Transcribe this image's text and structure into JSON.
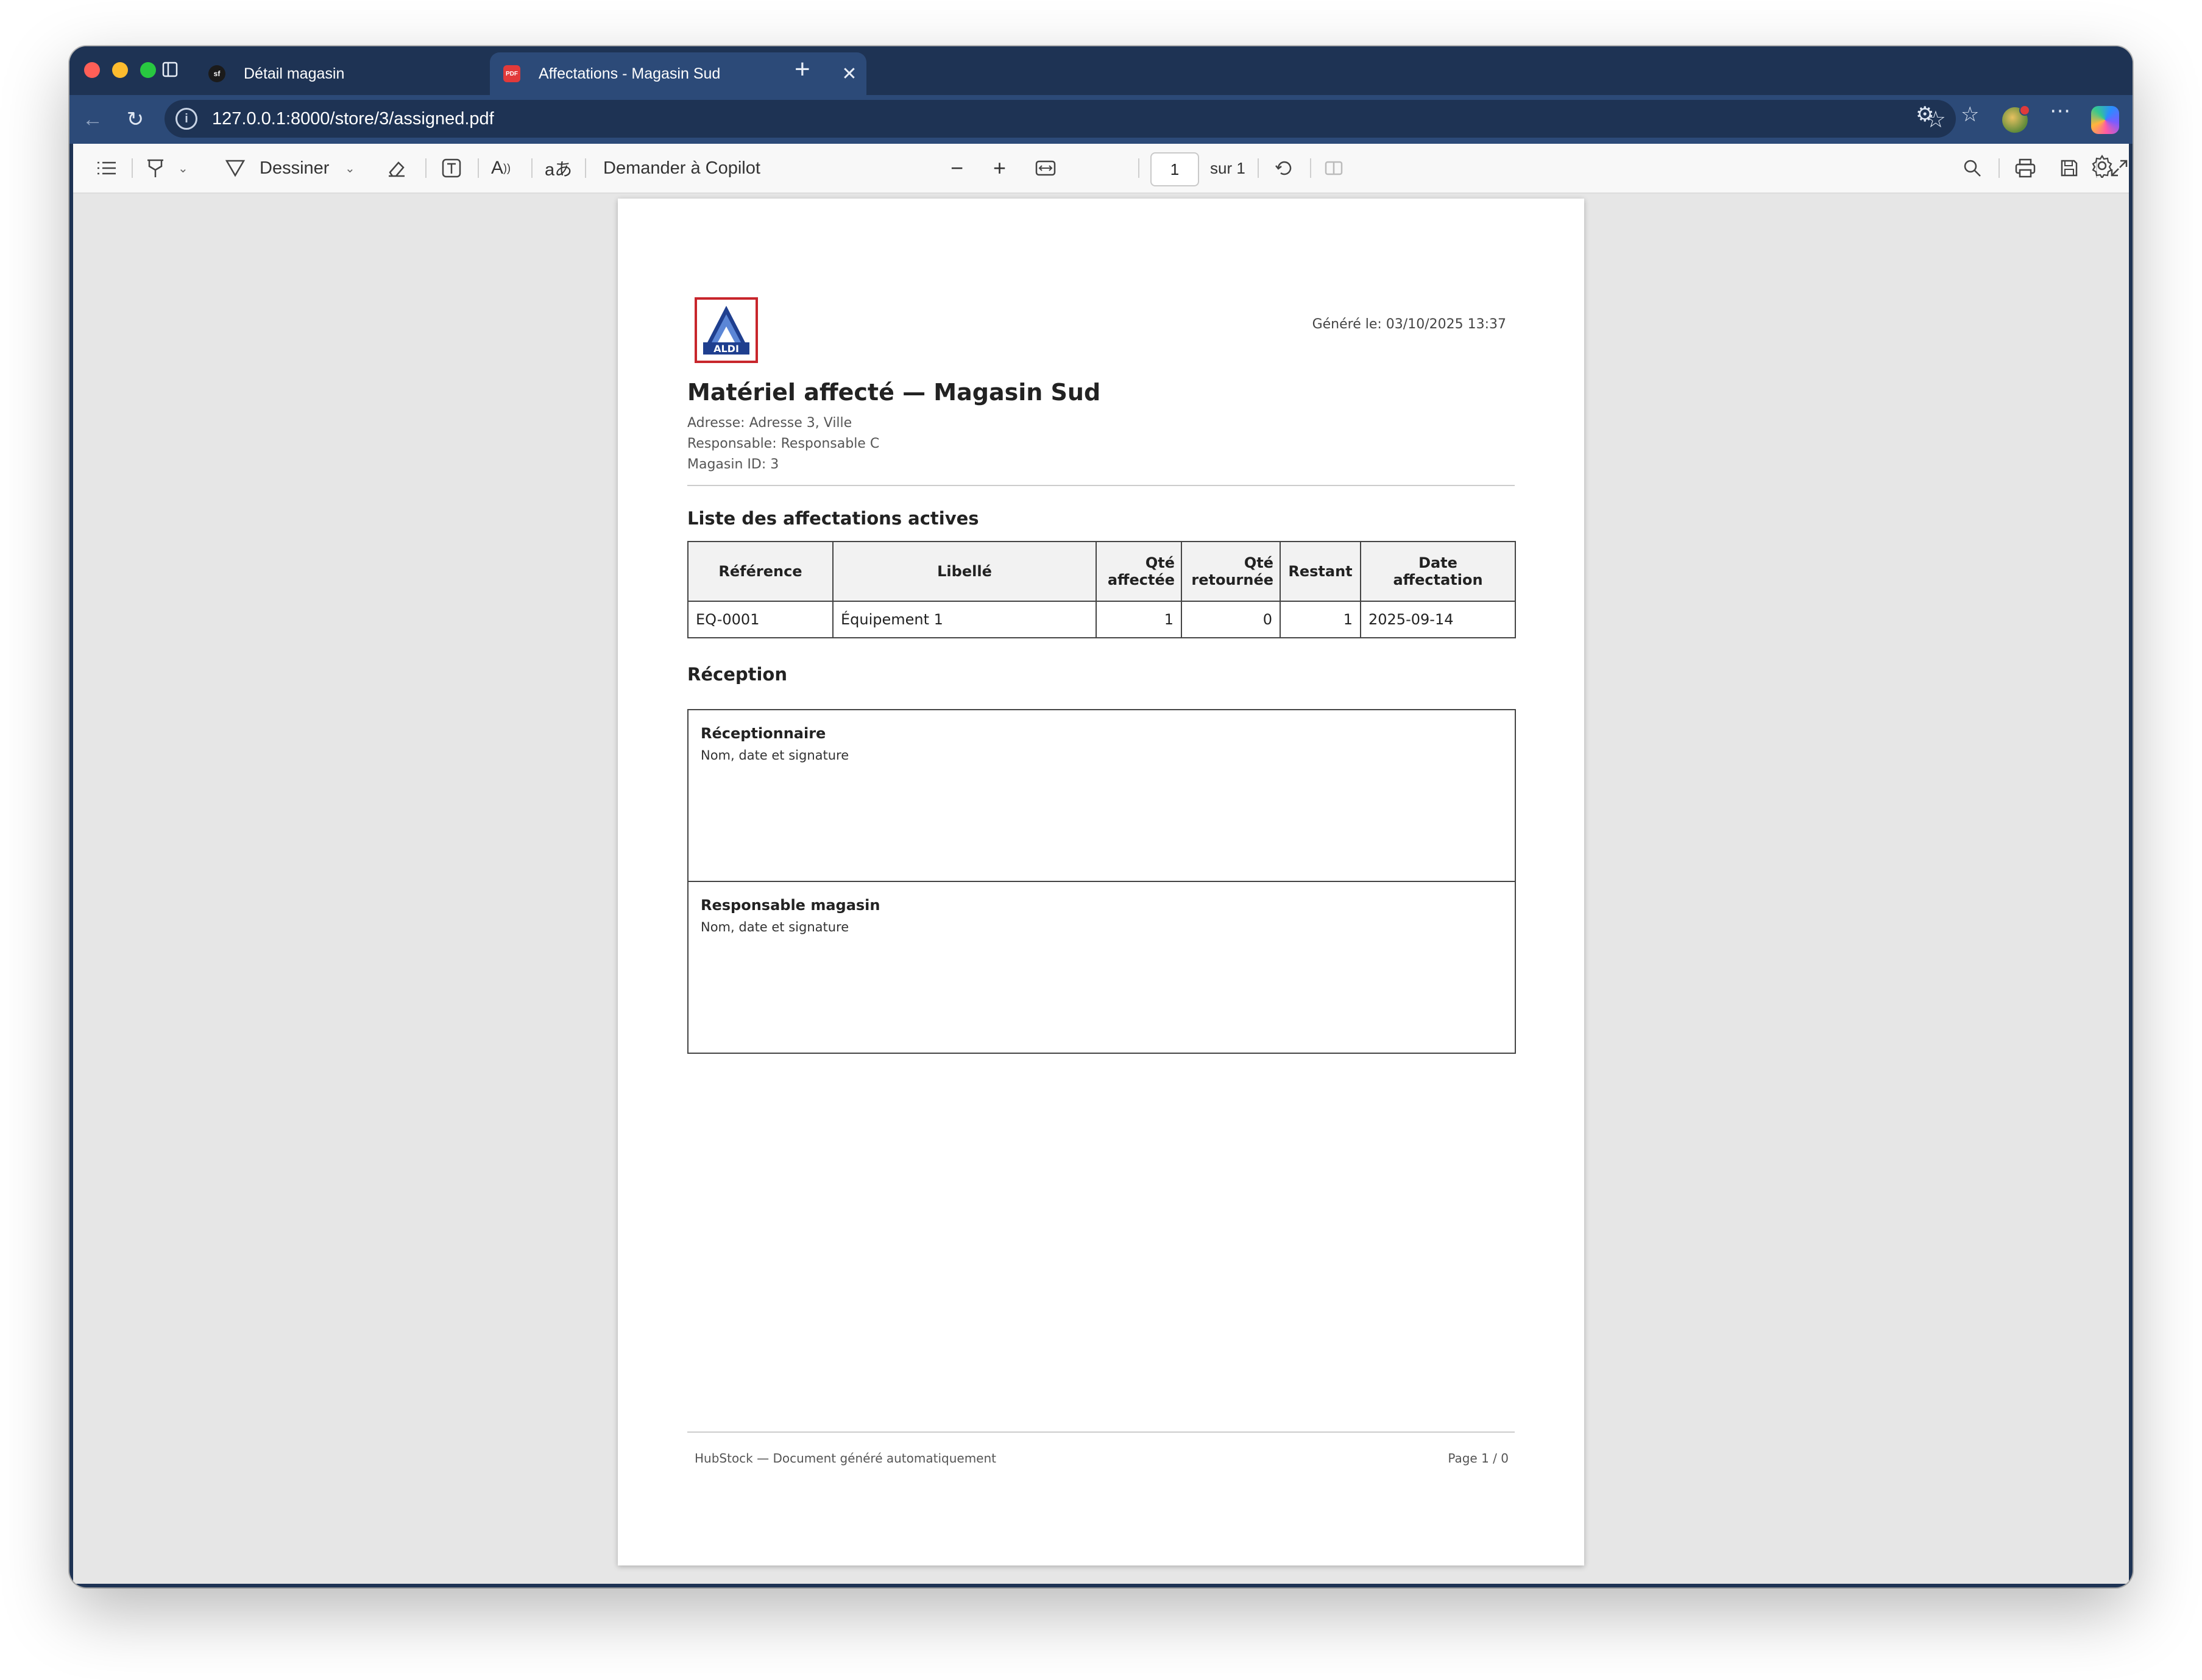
{
  "browser": {
    "tabs": [
      {
        "title": "Détail magasin",
        "favicon": "sf"
      },
      {
        "title": "Affectations - Magasin Sud",
        "favicon": "PDF"
      }
    ],
    "url": "127.0.0.1:8000/store/3/assigned.pdf"
  },
  "pdf_toolbar": {
    "draw_label": "Dessiner",
    "translate_label": "aあ",
    "copilot_label": "Demander à Copilot",
    "page_current": "1",
    "page_total": "sur 1"
  },
  "document": {
    "logo_text": "ALDI",
    "generated": "Généré le: 03/10/2025 13:37",
    "title": "Matériel affecté — Magasin Sud",
    "address": "Adresse: Adresse 3, Ville",
    "manager": "Responsable: Responsable C",
    "store_id": "Magasin ID: 3",
    "list_heading": "Liste des affectations actives",
    "table": {
      "headers": [
        "Référence",
        "Libellé",
        "Qté affectée",
        "Qté retournée",
        "Restant",
        "Date affectation"
      ],
      "rows": [
        [
          "EQ-0001",
          "Équipement 1",
          "1",
          "0",
          "1",
          "2025-09-14"
        ]
      ]
    },
    "reception_heading": "Réception",
    "signatures": [
      {
        "label": "Réceptionnaire",
        "sub": "Nom, date et signature"
      },
      {
        "label": "Responsable magasin",
        "sub": "Nom, date et signature"
      }
    ],
    "footer_left": "HubStock — Document généré automatiquement",
    "footer_right": "Page 1 / 0"
  }
}
